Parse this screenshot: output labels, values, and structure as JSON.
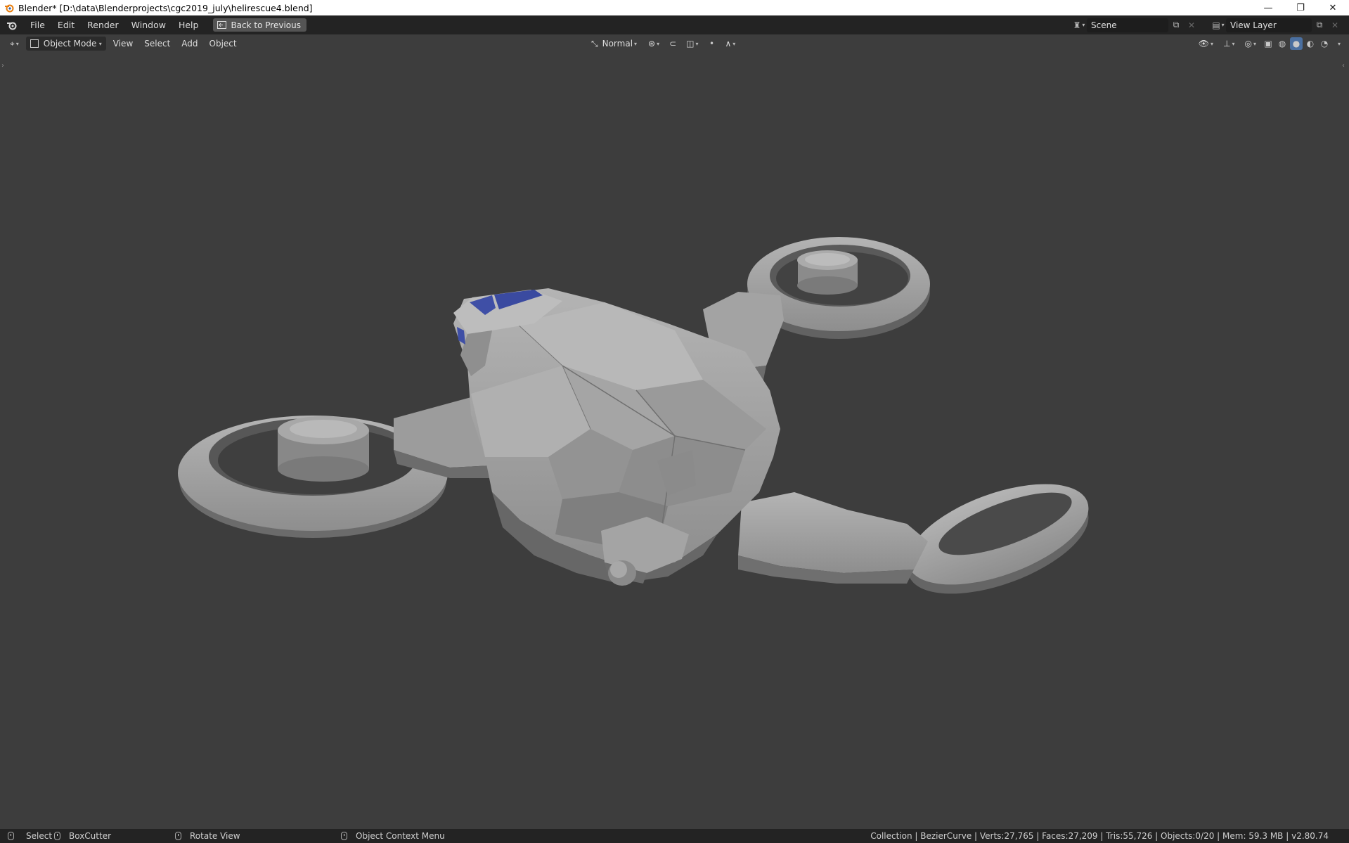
{
  "window": {
    "title": "Blender* [D:\\data\\Blenderprojects\\cgc2019_july\\helirescue4.blend]",
    "minimize": "—",
    "restore": "❐",
    "close": "✕"
  },
  "topbar": {
    "menus": [
      "File",
      "Edit",
      "Render",
      "Window",
      "Help"
    ],
    "back_button": "Back to Previous",
    "scene": "Scene",
    "view_layer": "View Layer"
  },
  "viewport_header": {
    "mode": "Object Mode",
    "menus": [
      "View",
      "Select",
      "Add",
      "Object"
    ],
    "transform_orientation": "Normal"
  },
  "statusbar": {
    "select": "Select",
    "boxcutter": "BoxCutter",
    "rotate": "Rotate View",
    "context_menu": "Object Context Menu",
    "stats": "Collection | BezierCurve | Verts:27,765 | Faces:27,209 | Tris:55,726 | Objects:0/20 | Mem: 59.3 MB | v2.80.74"
  },
  "colors": {
    "accent": "#4a6fa0",
    "window_glass": "#3f4fa6"
  }
}
